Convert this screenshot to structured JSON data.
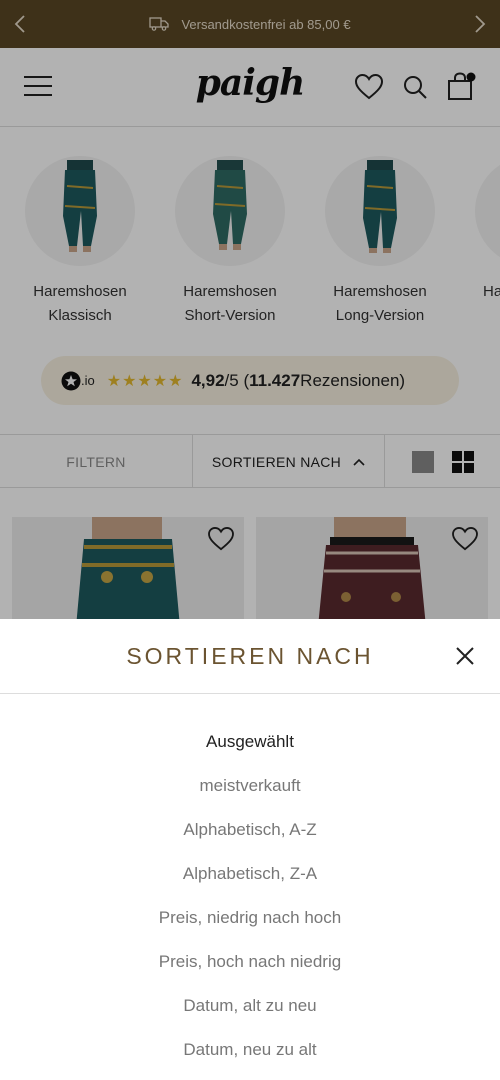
{
  "announcement": {
    "text": "Versandkostenfrei ab 85,00 €"
  },
  "header": {
    "logo": "paigh"
  },
  "categories": [
    {
      "label_line1": "Haremshosen",
      "label_line2": "Klassisch"
    },
    {
      "label_line1": "Haremshosen",
      "label_line2": "Short-Version"
    },
    {
      "label_line1": "Haremshosen",
      "label_line2": "Long-Version"
    },
    {
      "label_line1": "Ha"
    }
  ],
  "rating": {
    "provider": ".io",
    "stars": "★★★★★",
    "score": "4,92",
    "scale": "/5 (",
    "count": "11.427",
    "suffix": " Rezensionen)"
  },
  "filterbar": {
    "filter_label": "FILTERN",
    "sort_label": "SORTIEREN NACH"
  },
  "sort_sheet": {
    "title": "SORTIEREN NACH",
    "options": [
      "Ausgewählt",
      "meistverkauft",
      "Alphabetisch, A-Z",
      "Alphabetisch, Z-A",
      "Preis, niedrig nach hoch",
      "Preis, hoch nach niedrig",
      "Datum, alt zu neu",
      "Datum, neu zu alt"
    ],
    "selected_index": 0
  },
  "colors": {
    "announcement_bg": "#5a4724",
    "accent_brown": "#6b5431",
    "rating_bg": "#f6f0e0",
    "star": "#e3b82f"
  }
}
